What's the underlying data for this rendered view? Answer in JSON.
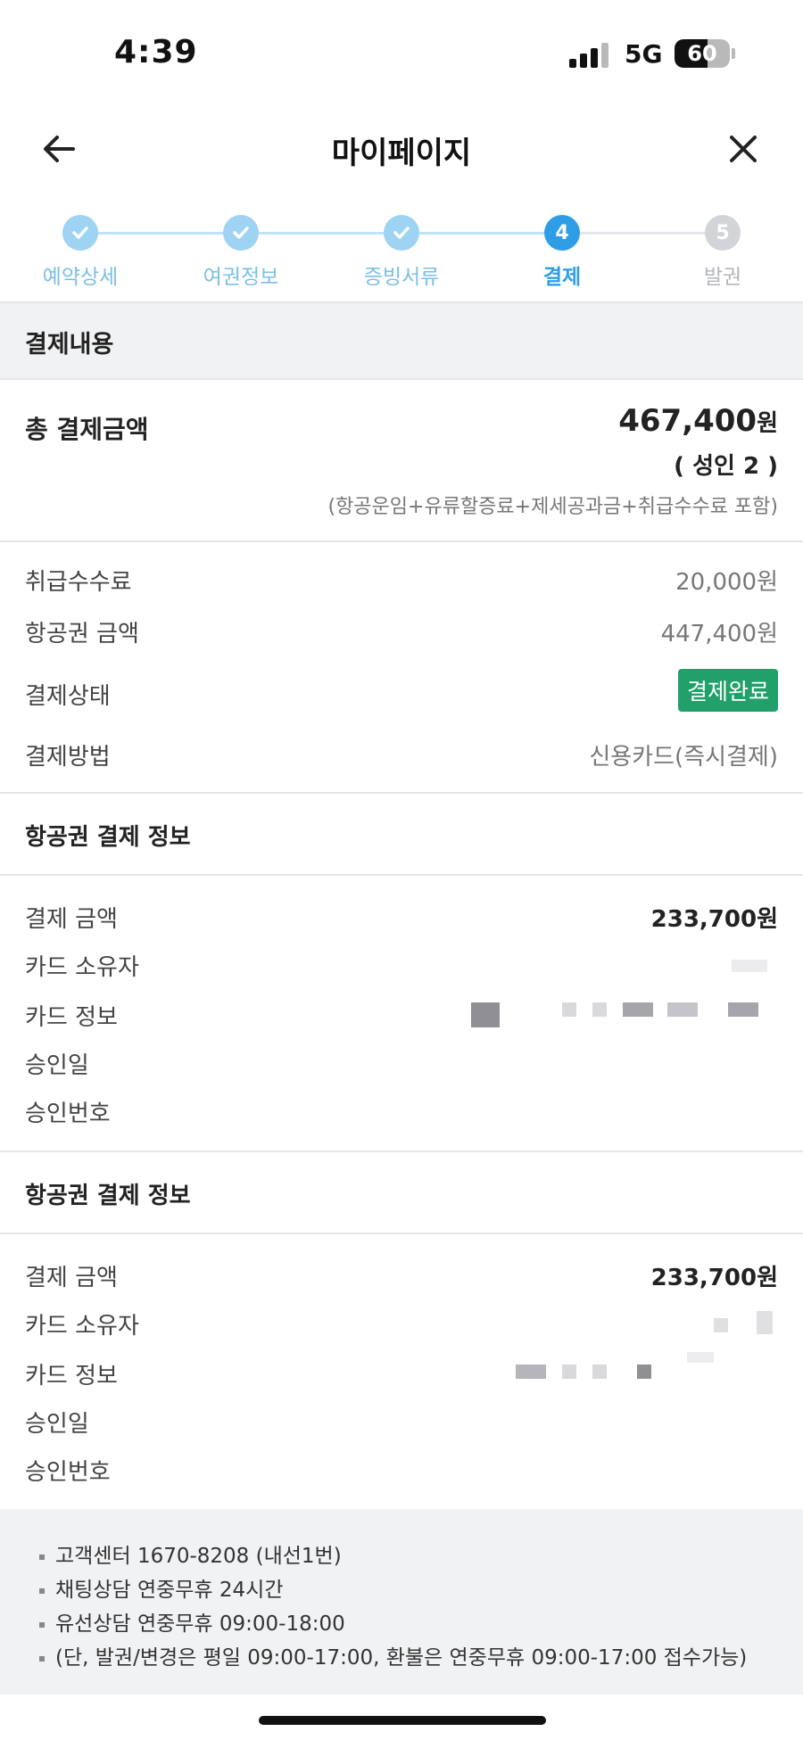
{
  "status_bar": {
    "time": "4:39",
    "network": "5G",
    "battery_level": "60",
    "battery_fraction": 0.6
  },
  "header": {
    "title": "마이페이지"
  },
  "stepper": {
    "steps": [
      {
        "label": "예약상세",
        "state": "done",
        "number": ""
      },
      {
        "label": "여권정보",
        "state": "done",
        "number": ""
      },
      {
        "label": "증빙서류",
        "state": "done",
        "number": ""
      },
      {
        "label": "결제",
        "state": "active",
        "number": "4"
      },
      {
        "label": "발권",
        "state": "pending",
        "number": "5"
      }
    ],
    "colors": {
      "done": "#9fd3f3",
      "active": "#2f9de6",
      "pending": "#d2d4d8"
    }
  },
  "payment_section": {
    "title": "결제내용",
    "total_label": "총 결제금액",
    "total_amount": "467,400",
    "total_unit": "원",
    "total_persons": "( 성인 2 )",
    "total_note": "(항공운임+유류할증료+제세공과금+취급수수료 포함)",
    "rows": [
      {
        "label": "취급수수료",
        "value": "20,000원"
      },
      {
        "label": "항공권 금액",
        "value": "447,400원"
      },
      {
        "label": "결제상태",
        "value": "결제완료"
      },
      {
        "label": "결제방법",
        "value": "신용카드(즉시결제)"
      }
    ],
    "status_color": "#22a06b"
  },
  "ticket_payments": [
    {
      "title": "항공권 결제 정보",
      "amount_label": "결제 금액",
      "amount": "233,700원",
      "owner_label": "카드 소유자",
      "card_label": "카드 정보",
      "approved_date_label": "승인일",
      "approval_no_label": "승인번호"
    },
    {
      "title": "항공권 결제 정보",
      "amount_label": "결제 금액",
      "amount": "233,700원",
      "owner_label": "카드 소유자",
      "card_label": "카드 정보",
      "approved_date_label": "승인일",
      "approval_no_label": "승인번호"
    }
  ],
  "footer": {
    "items": [
      "고객센터 1670-8208 (내선1번)",
      "채팅상담 연중무휴 24시간",
      "유선상담 연중무휴 09:00-18:00",
      "(단, 발권/변경은 평일 09:00-17:00, 환불은 연중무휴 09:00-17:00 접수가능)"
    ]
  }
}
